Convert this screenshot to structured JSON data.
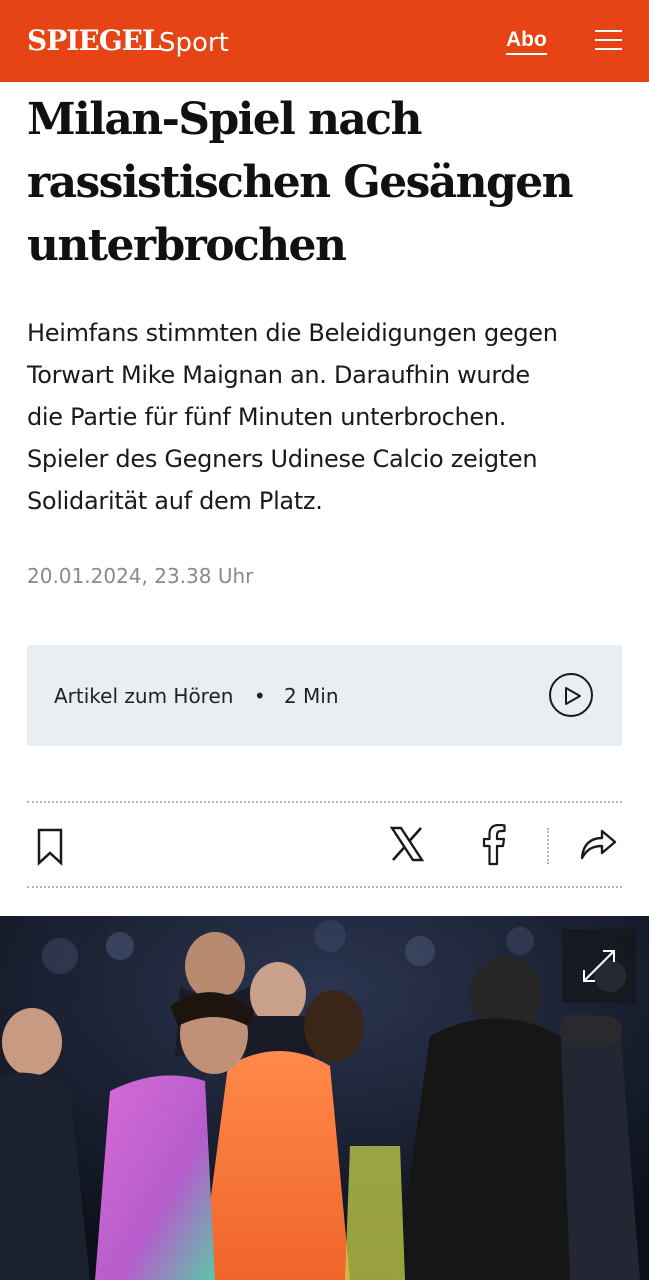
{
  "header": {
    "logo": "SPIEGEL",
    "section": "Sport",
    "abo_label": "Abo",
    "brand_color": "#e64415",
    "menu_icon": "hamburger-menu-icon"
  },
  "article": {
    "headline_lines": [
      "Milan-Spiel nach",
      "rassistischen Gesängen",
      "unterbrochen"
    ],
    "lead_lines": [
      "Heimfans stimmten die Beleidigungen gegen",
      "Torwart Mike Maignan an. Daraufhin wurde",
      "die Partie für fünf Minuten unterbrochen.",
      "Spieler des Gegners Udinese Calcio zeigten",
      "Solidarität auf dem Platz."
    ],
    "date": "20.01.2024, 23.38 Uhr"
  },
  "audio": {
    "label": "Artikel zum Hören",
    "separator": "•",
    "duration": "2 Min",
    "play_icon": "play-icon",
    "background": "#e8eef1"
  },
  "actions": {
    "bookmark_icon": "bookmark-icon",
    "x_icon": "x-twitter-icon",
    "facebook_icon": "facebook-icon",
    "share_icon": "share-icon"
  },
  "photo": {
    "expand_icon": "expand-icon"
  }
}
